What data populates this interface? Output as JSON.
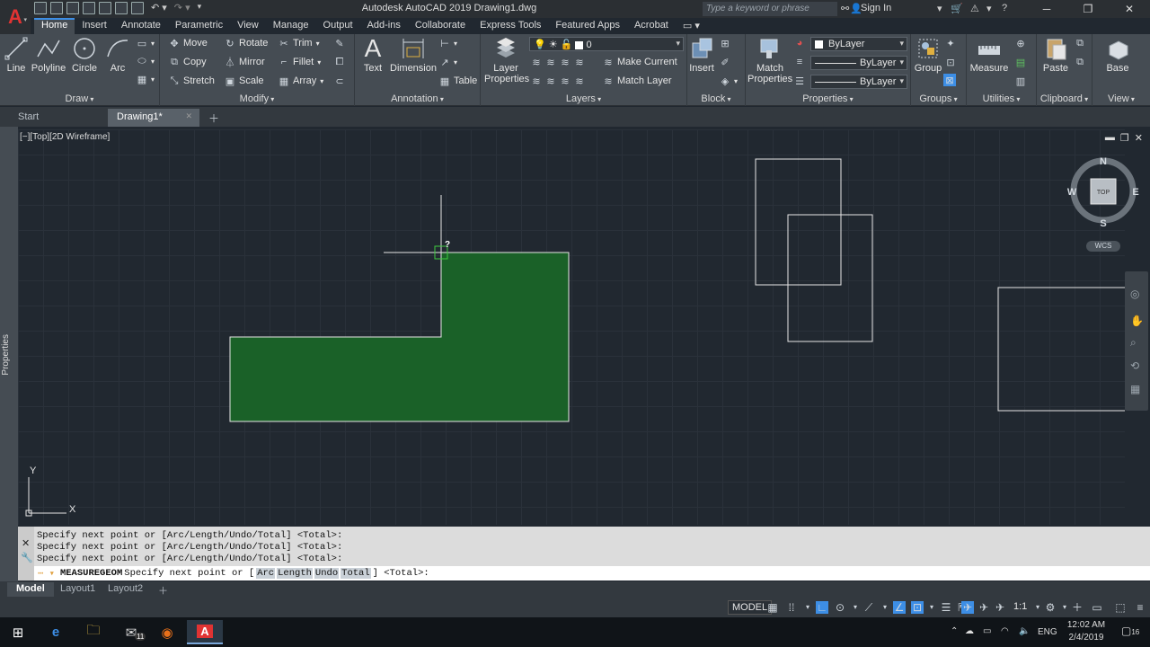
{
  "app": {
    "window_title": "Autodesk AutoCAD 2019    Drawing1.dwg",
    "search_placeholder": "Type a keyword or phrase",
    "sign_in": "Sign In"
  },
  "ribbon_tabs": [
    "Home",
    "Insert",
    "Annotate",
    "Parametric",
    "View",
    "Manage",
    "Output",
    "Add-ins",
    "Collaborate",
    "Express Tools",
    "Featured Apps",
    "Acrobat"
  ],
  "ribbon": {
    "draw": {
      "title": "Draw",
      "line": "Line",
      "polyline": "Polyline",
      "circle": "Circle",
      "arc": "Arc"
    },
    "modify": {
      "title": "Modify",
      "move": "Move",
      "rotate": "Rotate",
      "trim": "Trim",
      "copy": "Copy",
      "mirror": "Mirror",
      "fillet": "Fillet",
      "stretch": "Stretch",
      "scale": "Scale",
      "array": "Array"
    },
    "annotation": {
      "title": "Annotation",
      "text": "Text",
      "dimension": "Dimension",
      "table": "Table"
    },
    "layers": {
      "title": "Layers",
      "layer_properties": "Layer\nProperties",
      "layer_value": "0",
      "make_current": "Make Current",
      "match_layer": "Match Layer"
    },
    "block": {
      "title": "Block",
      "insert": "Insert"
    },
    "properties": {
      "title": "Properties",
      "match_properties": "Match\nProperties",
      "color": "ByLayer",
      "linetype": "ByLayer",
      "lineweight": "ByLayer"
    },
    "groups": {
      "title": "Groups",
      "group": "Group"
    },
    "utilities": {
      "title": "Utilities",
      "measure": "Measure"
    },
    "clipboard": {
      "title": "Clipboard",
      "paste": "Paste"
    },
    "view": {
      "title": "View",
      "base": "Base"
    }
  },
  "doc_tabs": {
    "start": "Start",
    "drawing": "Drawing1*"
  },
  "viewport": {
    "label": "[−][Top][2D Wireframe]",
    "properties_palette": "Properties",
    "viewcube": {
      "n": "N",
      "s": "S",
      "e": "E",
      "w": "W",
      "top": "TOP"
    },
    "wcs": "WCS",
    "ucs_x": "X",
    "ucs_y": "Y",
    "cursor_tooltip": "?"
  },
  "command": {
    "history": [
      "Specify next point or [Arc/Length/Undo/Total] <Total>:",
      "Specify next point or [Arc/Length/Undo/Total] <Total>:",
      "Specify next point or [Arc/Length/Undo/Total] <Total>:"
    ],
    "input_command": "MEASUREGEOM",
    "input_prompt": "Specify next point or [",
    "options": [
      "Arc",
      "Length",
      "Undo",
      "Total"
    ],
    "input_suffix": "] <Total>:"
  },
  "layout_tabs": [
    "Model",
    "Layout1",
    "Layout2"
  ],
  "statusbar": {
    "model": "MODEL",
    "scale": "1:1"
  },
  "taskbar": {
    "lang": "ENG",
    "time": "12:02 AM",
    "date": "2/4/2019",
    "notifications": "16",
    "mail_badge": "11"
  },
  "colors": {
    "accent": "#3d8ee5",
    "fill_green": "#1a6128",
    "autocad_red": "#e03333"
  }
}
